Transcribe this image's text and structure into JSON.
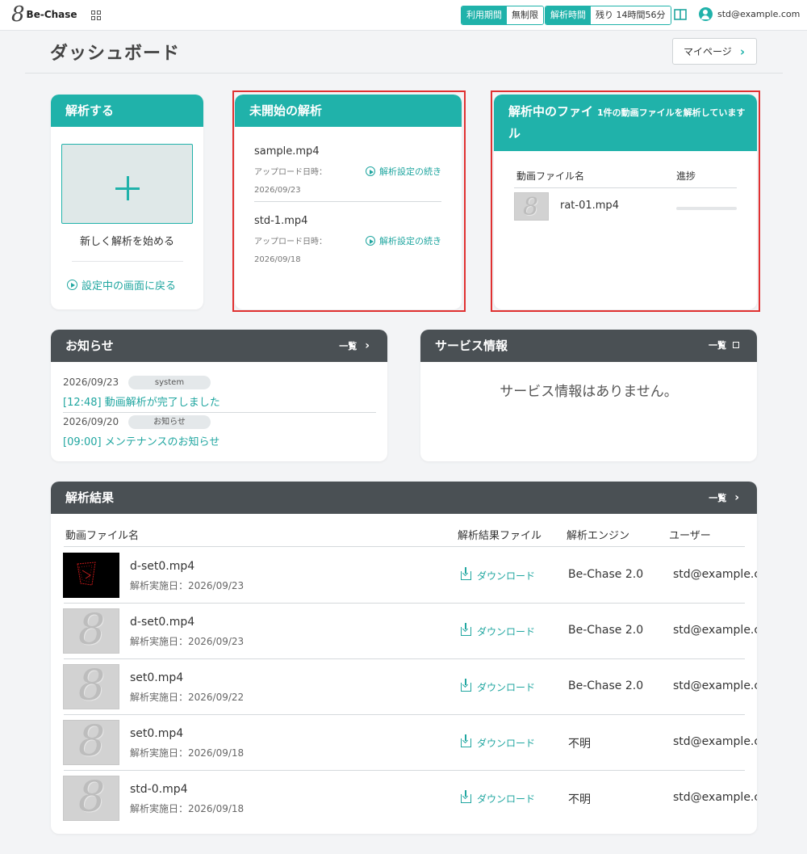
{
  "app": {
    "logo_mark": "8",
    "logo_text": "Be-Chase"
  },
  "header": {
    "period_label": "利用期間",
    "period_value": "無制限",
    "time_label": "解析時間",
    "time_value": "残り 14時間56分",
    "user_email": "std@example.com"
  },
  "page": {
    "title": "ダッシュボード",
    "mypage_label": "マイページ"
  },
  "analyze_card": {
    "title": "解析する",
    "start_label": "新しく解析を始める",
    "back_label": "設定中の画面に戻る"
  },
  "pending_card": {
    "title": "未開始の解析",
    "items": [
      {
        "name": "sample.mp4",
        "meta_label": "アップロード日時：",
        "date": "2026/09/23",
        "link": "解析設定の続き"
      },
      {
        "name": "std-1.mp4",
        "meta_label": "アップロード日時：",
        "date": "2026/09/18",
        "link": "解析設定の続き"
      }
    ]
  },
  "processing_card": {
    "title": "解析中のファイル",
    "message": "1件の動画ファイルを解析しています",
    "col_name": "動画ファイル名",
    "col_progress": "進捗",
    "items": [
      {
        "name": "rat-01.mp4",
        "progress": 0
      }
    ]
  },
  "news_card": {
    "title": "お知らせ",
    "list_label": "一覧",
    "items": [
      {
        "date": "2026/09/23",
        "tag": "system",
        "title": "[12:48] 動画解析が完了しました"
      },
      {
        "date": "2026/09/20",
        "tag": "お知らせ",
        "title": "[09:00] メンテナンスのお知らせ"
      }
    ]
  },
  "service_card": {
    "title": "サービス情報",
    "list_label": "一覧",
    "empty_message": "サービス情報はありません。"
  },
  "results_card": {
    "title": "解析結果",
    "list_label": "一覧",
    "columns": {
      "file": "動画ファイル名",
      "result": "解析結果ファイル",
      "engine": "解析エンジン",
      "user": "ユーザー"
    },
    "date_label": "解析実施日：",
    "rows": [
      {
        "name": "d-set0.mp4",
        "date": "2026/09/23",
        "download": "ダウンロード",
        "engine": "Be-Chase 2.0",
        "user": "std@example.com",
        "thumb": "dark-trace"
      },
      {
        "name": "d-set0.mp4",
        "date": "2026/09/23",
        "download": "ダウンロード",
        "engine": "Be-Chase 2.0",
        "user": "std@example.com",
        "thumb": "placeholder"
      },
      {
        "name": "set0.mp4",
        "date": "2026/09/22",
        "download": "ダウンロード",
        "engine": "Be-Chase 2.0",
        "user": "std@example.com",
        "thumb": "placeholder"
      },
      {
        "name": "set0.mp4",
        "date": "2026/09/18",
        "download": "ダウンロード",
        "engine": "不明",
        "user": "std@example.com",
        "thumb": "placeholder"
      },
      {
        "name": "std-0.mp4",
        "date": "2026/09/18",
        "download": "ダウンロード",
        "engine": "不明",
        "user": "std@example.com",
        "thumb": "placeholder"
      }
    ]
  },
  "colors": {
    "accent": "#20b2aa",
    "dark_header": "#4a5054",
    "highlight": "#e03131"
  },
  "icons": [
    "grid-icon",
    "book-icon",
    "user-icon",
    "chevron-right-icon",
    "plus-icon",
    "play-icon",
    "download-icon",
    "external-link-icon"
  ]
}
